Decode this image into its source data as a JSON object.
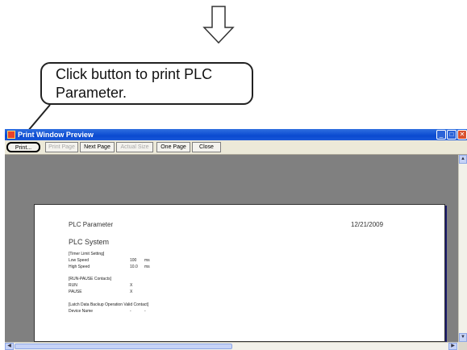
{
  "callout": {
    "text": "Click button to print PLC Parameter."
  },
  "window": {
    "title": "Print Window Preview",
    "controls": {
      "minimize": "_",
      "maximize": "□",
      "close": "✕"
    }
  },
  "toolbar": {
    "print": "Print...",
    "print_page": "Print Page",
    "next_page": "Next Page",
    "actual_size": "Actual Size",
    "one_page": "One Page",
    "close": "Close"
  },
  "document": {
    "title": "PLC Parameter",
    "date": "12/21/2009",
    "subtitle": "PLC System",
    "sections": [
      {
        "heading": "[Timer Limit Setting]",
        "rows": [
          {
            "label": "Low Speed",
            "value": "100",
            "unit": "ms"
          },
          {
            "label": "High Speed",
            "value": "10.0",
            "unit": "ms"
          }
        ]
      },
      {
        "heading": "[RUN-PAUSE Contacts]",
        "rows": [
          {
            "label": "RUN",
            "value": "X",
            "unit": ""
          },
          {
            "label": "PAUSE",
            "value": "X",
            "unit": ""
          }
        ]
      },
      {
        "heading": "[Latch Data Backup Operation Valid Contact]",
        "rows": [
          {
            "label": "Device Name",
            "value": "-",
            "unit": "-"
          }
        ]
      }
    ]
  },
  "scrollbars": {
    "up": "▲",
    "down": "▼",
    "left": "◀",
    "right": "▶"
  },
  "icons": {
    "arrow": "down-arrow-icon",
    "app": "app-icon"
  }
}
